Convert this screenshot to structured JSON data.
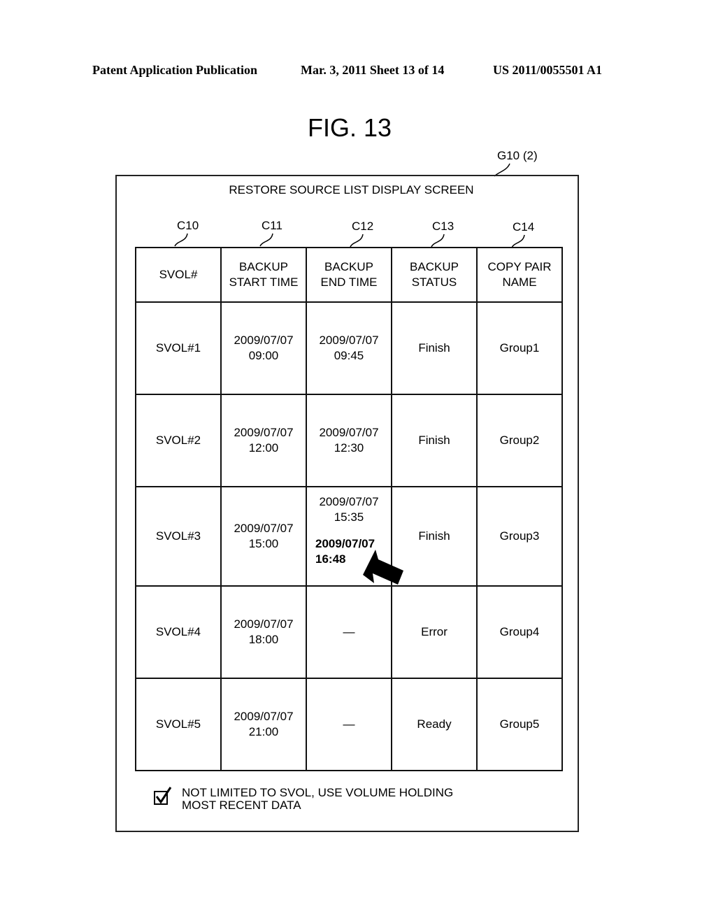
{
  "header": {
    "left": "Patent Application Publication",
    "date_sheet": "Mar. 3, 2011   Sheet 13 of 14",
    "pub_number": "US 2011/0055501 A1"
  },
  "figure": {
    "title": "FIG. 13",
    "screen_ref": "G10 (2)",
    "screen_title": "RESTORE SOURCE LIST DISPLAY SCREEN",
    "column_refs": [
      "C10",
      "C11",
      "C12",
      "C13",
      "C14"
    ]
  },
  "table": {
    "headers": [
      [
        "SVOL#"
      ],
      [
        "BACKUP",
        "START TIME"
      ],
      [
        "BACKUP",
        "END TIME"
      ],
      [
        "BACKUP",
        "STATUS"
      ],
      [
        "COPY PAIR",
        "NAME"
      ]
    ],
    "rows": [
      {
        "svol": "SVOL#1",
        "start": [
          "2009/07/07",
          "09:00"
        ],
        "end": [
          "2009/07/07",
          "09:45"
        ],
        "status": "Finish",
        "group": "Group1"
      },
      {
        "svol": "SVOL#2",
        "start": [
          "2009/07/07",
          "12:00"
        ],
        "end": [
          "2009/07/07",
          "12:30"
        ],
        "status": "Finish",
        "group": "Group2"
      },
      {
        "svol": "SVOL#3",
        "start": [
          "2009/07/07",
          "15:00"
        ],
        "end": [
          "2009/07/07",
          "15:35"
        ],
        "end_updated": [
          "2009/07/07",
          "16:48"
        ],
        "status": "Finish",
        "group": "Group3"
      },
      {
        "svol": "SVOL#4",
        "start": [
          "2009/07/07",
          "18:00"
        ],
        "end": [
          "—"
        ],
        "status": "Error",
        "group": "Group4"
      },
      {
        "svol": "SVOL#5",
        "start": [
          "2009/07/07",
          "21:00"
        ],
        "end": [
          "—"
        ],
        "status": "Ready",
        "group": "Group5"
      }
    ]
  },
  "option": {
    "checked": true,
    "label_line1": "NOT LIMITED TO SVOL, USE VOLUME HOLDING",
    "label_line2": "MOST RECENT DATA"
  }
}
